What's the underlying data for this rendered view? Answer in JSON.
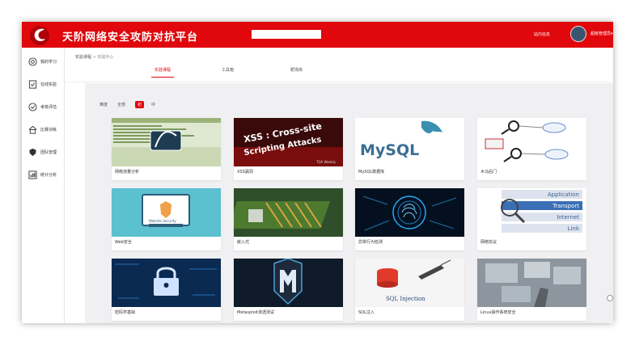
{
  "header": {
    "title": "天阶网络安全攻防对抗平台",
    "search_placeholder": "",
    "messages": "站内信息",
    "user": "超级管理员▾"
  },
  "sidebar": {
    "items": [
      {
        "label": "我的学习",
        "icon": "target-icon"
      },
      {
        "label": "在线实验",
        "icon": "doc-check-icon"
      },
      {
        "label": "考核评估",
        "icon": "badge-check-icon"
      },
      {
        "label": "比赛训练",
        "icon": "home-chart-icon"
      },
      {
        "label": "团队管理",
        "icon": "shield-icon"
      },
      {
        "label": "统计分析",
        "icon": "stats-icon"
      }
    ]
  },
  "breadcrumb": {
    "home": "实验课程",
    "sep": ">",
    "current": "实验中心"
  },
  "tabs": [
    "实验课程",
    "工具箱",
    "靶场库"
  ],
  "filters": {
    "label": "难度",
    "options": [
      "全部",
      "初",
      "中"
    ],
    "active_index": 1
  },
  "cards": [
    {
      "title": "网络流量分析"
    },
    {
      "title": "XSS漏洞"
    },
    {
      "title": "MySQL数据库"
    },
    {
      "title": "木马后门"
    },
    {
      "title": "Web安全"
    },
    {
      "title": "嵌入式"
    },
    {
      "title": "异常行为检测"
    },
    {
      "title": "网络协议"
    },
    {
      "title": "密码学基础"
    },
    {
      "title": "Metasploit渗透测试"
    },
    {
      "title": "SQL注入"
    },
    {
      "title": "Linux操作系统安全"
    }
  ],
  "thumbs": {
    "xss_line1": "XSS : Cross-site",
    "xss_line2": "Scripting Attacks",
    "xss_tag": "TQA Weekly",
    "mysql": "MySQL",
    "web_shield": "Website Security",
    "proto": [
      "Application",
      "Transport",
      "Internet",
      "Link"
    ],
    "sqli": "SQL Injection"
  },
  "colors": {
    "brand": "#e0070d",
    "accent": "#e0070d"
  }
}
